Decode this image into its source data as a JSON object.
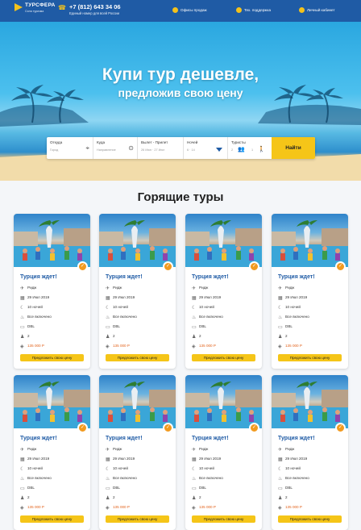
{
  "header": {
    "brand": "ТУРСФЕРА",
    "brand_tagline": "Сила туризма",
    "phone": "+7 (812) 643 34 06",
    "phone_note": "Единый номер для всей России",
    "links": [
      "Офисы продаж",
      "Тех. поддержка",
      "Личный кабинет"
    ]
  },
  "hero": {
    "title": "Купи тур дешевле,",
    "subtitle": "предложив свою цену"
  },
  "search": {
    "from_label": "Откуда",
    "from_value": "Город",
    "to_label": "Куда",
    "to_value": "Направление",
    "dates_label": "Вылет - Прилет",
    "dates_value": "26 Июн · 27 Июл",
    "nights_label": "Ночей",
    "nights_value": "6 · 14",
    "tourists_label": "Туристы",
    "adults": "2",
    "children": "1",
    "button": "Найти"
  },
  "section_title": "Горящие туры",
  "tour_card": {
    "title": "Турция ждет!",
    "city": "Ридж",
    "date": "29 Июл 2019",
    "nights": "10 ночей",
    "meal": "Все включено",
    "room": "DBL",
    "tourists": "2",
    "price": "135 000 Р",
    "button": "Предложить свою цену"
  },
  "colors": {
    "brand_blue": "#1f5ba5",
    "accent_yellow": "#f5c518",
    "price_orange": "#e2621b",
    "badge_orange": "#f29a1f"
  },
  "icons": [
    "phone-icon",
    "pin-icon",
    "headset-icon",
    "user-icon",
    "plane-icon",
    "calendar-icon",
    "moon-icon",
    "meal-icon",
    "bed-icon",
    "people-icon",
    "tag-icon"
  ]
}
